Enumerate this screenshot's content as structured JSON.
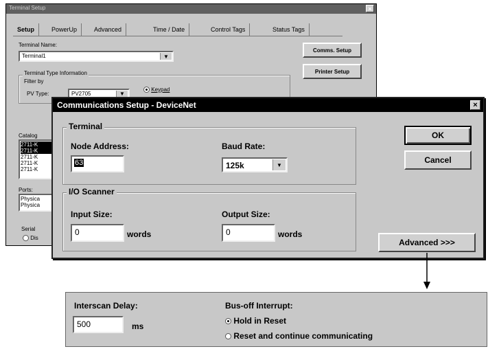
{
  "back_window": {
    "title": "Terminal Setup",
    "close_glyph": "×",
    "tabs": [
      {
        "label": "Setup"
      },
      {
        "label": "PowerUp"
      },
      {
        "label": "Advanced"
      },
      {
        "label": "Time / Date"
      },
      {
        "label": "Control Tags"
      },
      {
        "label": "Status Tags"
      }
    ],
    "terminal_name_label": "Terminal Name:",
    "terminal_name_value": "Terminal1",
    "comms_setup_button": "Comms. Setup",
    "printer_setup_button": "Printer Setup",
    "terminal_type_group": "Terminal Type Information",
    "filter_by_label": "Filter by",
    "pv_type_label": "PV Type:",
    "pv_type_value": "PV2705",
    "keypad_radio": "Keypad",
    "catalog_label": "Catalog",
    "catalog_items": [
      "2711-K",
      "2711-K",
      "2711-K",
      "2711-K",
      "2711-K"
    ],
    "ports_label": "Ports:",
    "ports_items": [
      "Physica",
      "Physica"
    ],
    "serial_label": "Serial",
    "serial_radio": "Dis"
  },
  "dialog": {
    "title": "Communications Setup - DeviceNet",
    "close_glyph": "×",
    "terminal_group": "Terminal",
    "node_address_label": "Node Address:",
    "node_address_value": "63",
    "baud_rate_label": "Baud Rate:",
    "baud_rate_value": "125k",
    "io_scanner_group": "I/O Scanner",
    "input_size_label": "Input Size:",
    "input_size_value": "0",
    "input_units": "words",
    "output_size_label": "Output Size:",
    "output_size_value": "0",
    "output_units": "words",
    "ok_button": "OK",
    "cancel_button": "Cancel",
    "advanced_button": "Advanced >>>"
  },
  "advanced_panel": {
    "interscan_delay_label": "Interscan Delay:",
    "interscan_delay_value": "500",
    "interscan_units": "ms",
    "bus_off_label": "Bus-off Interrupt:",
    "hold_in_reset": "Hold in Reset",
    "reset_continue": "Reset and continue communicating",
    "selected_option": "hold_in_reset"
  },
  "icons": {
    "arrow": "down-arrow-icon",
    "dropdown": "chevron-down-icon"
  }
}
